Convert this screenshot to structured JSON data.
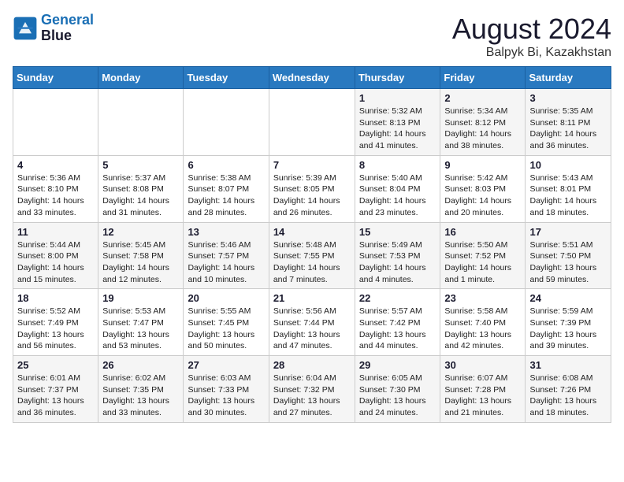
{
  "logo": {
    "line1": "General",
    "line2": "Blue"
  },
  "title": "August 2024",
  "subtitle": "Balpyk Bi, Kazakhstan",
  "days_of_week": [
    "Sunday",
    "Monday",
    "Tuesday",
    "Wednesday",
    "Thursday",
    "Friday",
    "Saturday"
  ],
  "weeks": [
    [
      {
        "num": "",
        "info": ""
      },
      {
        "num": "",
        "info": ""
      },
      {
        "num": "",
        "info": ""
      },
      {
        "num": "",
        "info": ""
      },
      {
        "num": "1",
        "info": "Sunrise: 5:32 AM\nSunset: 8:13 PM\nDaylight: 14 hours\nand 41 minutes."
      },
      {
        "num": "2",
        "info": "Sunrise: 5:34 AM\nSunset: 8:12 PM\nDaylight: 14 hours\nand 38 minutes."
      },
      {
        "num": "3",
        "info": "Sunrise: 5:35 AM\nSunset: 8:11 PM\nDaylight: 14 hours\nand 36 minutes."
      }
    ],
    [
      {
        "num": "4",
        "info": "Sunrise: 5:36 AM\nSunset: 8:10 PM\nDaylight: 14 hours\nand 33 minutes."
      },
      {
        "num": "5",
        "info": "Sunrise: 5:37 AM\nSunset: 8:08 PM\nDaylight: 14 hours\nand 31 minutes."
      },
      {
        "num": "6",
        "info": "Sunrise: 5:38 AM\nSunset: 8:07 PM\nDaylight: 14 hours\nand 28 minutes."
      },
      {
        "num": "7",
        "info": "Sunrise: 5:39 AM\nSunset: 8:05 PM\nDaylight: 14 hours\nand 26 minutes."
      },
      {
        "num": "8",
        "info": "Sunrise: 5:40 AM\nSunset: 8:04 PM\nDaylight: 14 hours\nand 23 minutes."
      },
      {
        "num": "9",
        "info": "Sunrise: 5:42 AM\nSunset: 8:03 PM\nDaylight: 14 hours\nand 20 minutes."
      },
      {
        "num": "10",
        "info": "Sunrise: 5:43 AM\nSunset: 8:01 PM\nDaylight: 14 hours\nand 18 minutes."
      }
    ],
    [
      {
        "num": "11",
        "info": "Sunrise: 5:44 AM\nSunset: 8:00 PM\nDaylight: 14 hours\nand 15 minutes."
      },
      {
        "num": "12",
        "info": "Sunrise: 5:45 AM\nSunset: 7:58 PM\nDaylight: 14 hours\nand 12 minutes."
      },
      {
        "num": "13",
        "info": "Sunrise: 5:46 AM\nSunset: 7:57 PM\nDaylight: 14 hours\nand 10 minutes."
      },
      {
        "num": "14",
        "info": "Sunrise: 5:48 AM\nSunset: 7:55 PM\nDaylight: 14 hours\nand 7 minutes."
      },
      {
        "num": "15",
        "info": "Sunrise: 5:49 AM\nSunset: 7:53 PM\nDaylight: 14 hours\nand 4 minutes."
      },
      {
        "num": "16",
        "info": "Sunrise: 5:50 AM\nSunset: 7:52 PM\nDaylight: 14 hours\nand 1 minute."
      },
      {
        "num": "17",
        "info": "Sunrise: 5:51 AM\nSunset: 7:50 PM\nDaylight: 13 hours\nand 59 minutes."
      }
    ],
    [
      {
        "num": "18",
        "info": "Sunrise: 5:52 AM\nSunset: 7:49 PM\nDaylight: 13 hours\nand 56 minutes."
      },
      {
        "num": "19",
        "info": "Sunrise: 5:53 AM\nSunset: 7:47 PM\nDaylight: 13 hours\nand 53 minutes."
      },
      {
        "num": "20",
        "info": "Sunrise: 5:55 AM\nSunset: 7:45 PM\nDaylight: 13 hours\nand 50 minutes."
      },
      {
        "num": "21",
        "info": "Sunrise: 5:56 AM\nSunset: 7:44 PM\nDaylight: 13 hours\nand 47 minutes."
      },
      {
        "num": "22",
        "info": "Sunrise: 5:57 AM\nSunset: 7:42 PM\nDaylight: 13 hours\nand 44 minutes."
      },
      {
        "num": "23",
        "info": "Sunrise: 5:58 AM\nSunset: 7:40 PM\nDaylight: 13 hours\nand 42 minutes."
      },
      {
        "num": "24",
        "info": "Sunrise: 5:59 AM\nSunset: 7:39 PM\nDaylight: 13 hours\nand 39 minutes."
      }
    ],
    [
      {
        "num": "25",
        "info": "Sunrise: 6:01 AM\nSunset: 7:37 PM\nDaylight: 13 hours\nand 36 minutes."
      },
      {
        "num": "26",
        "info": "Sunrise: 6:02 AM\nSunset: 7:35 PM\nDaylight: 13 hours\nand 33 minutes."
      },
      {
        "num": "27",
        "info": "Sunrise: 6:03 AM\nSunset: 7:33 PM\nDaylight: 13 hours\nand 30 minutes."
      },
      {
        "num": "28",
        "info": "Sunrise: 6:04 AM\nSunset: 7:32 PM\nDaylight: 13 hours\nand 27 minutes."
      },
      {
        "num": "29",
        "info": "Sunrise: 6:05 AM\nSunset: 7:30 PM\nDaylight: 13 hours\nand 24 minutes."
      },
      {
        "num": "30",
        "info": "Sunrise: 6:07 AM\nSunset: 7:28 PM\nDaylight: 13 hours\nand 21 minutes."
      },
      {
        "num": "31",
        "info": "Sunrise: 6:08 AM\nSunset: 7:26 PM\nDaylight: 13 hours\nand 18 minutes."
      }
    ]
  ]
}
